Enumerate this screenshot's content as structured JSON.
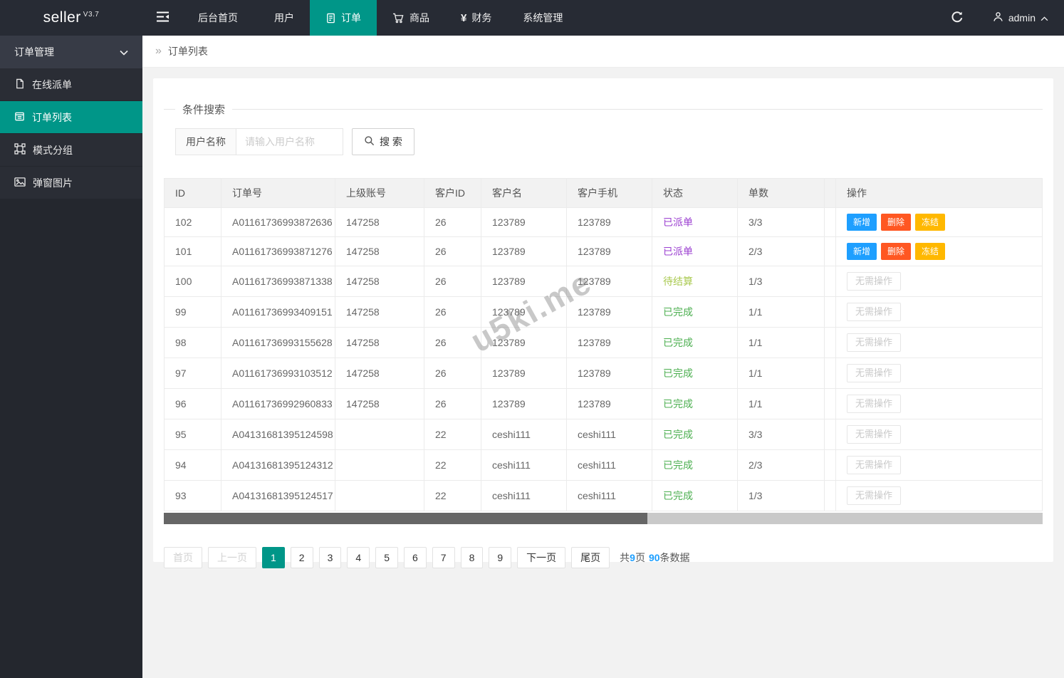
{
  "navbar": {
    "logo_text": "seller",
    "version": "V3.7",
    "items": [
      {
        "label": "后台首页",
        "icon": null,
        "active": false
      },
      {
        "label": "用户",
        "icon": "user-icon",
        "active": false
      },
      {
        "label": "订单",
        "icon": "order-icon",
        "active": true
      },
      {
        "label": "商品",
        "icon": "cart-icon",
        "active": false
      },
      {
        "label": "财务",
        "icon": "yen-icon",
        "active": false
      },
      {
        "label": "系统管理",
        "icon": null,
        "active": false
      }
    ],
    "user_name": "admin"
  },
  "sidebar": {
    "section_label": "订单管理",
    "items": [
      {
        "label": "在线派单",
        "icon": "file-icon",
        "active": false
      },
      {
        "label": "订单列表",
        "icon": "list-icon",
        "active": true
      },
      {
        "label": "模式分组",
        "icon": "group-icon",
        "active": false
      },
      {
        "label": "弹窗图片",
        "icon": "image-icon",
        "active": false
      }
    ]
  },
  "breadcrumb": {
    "arrow": "»",
    "label": "订单列表"
  },
  "search": {
    "legend": "条件搜索",
    "field_label": "用户名称",
    "placeholder": "请输入用户名称",
    "button_label": "搜 索"
  },
  "icons": {
    "yen": "¥"
  },
  "table": {
    "columns": [
      "ID",
      "订单号",
      "上级账号",
      "客户ID",
      "客户名",
      "客户手机",
      "状态",
      "单数",
      "操作"
    ],
    "status_colors": {
      "已派单": "#9b3fd0",
      "待结算": "#a9c94f",
      "已完成": "#4caf50"
    },
    "action_buttons": [
      {
        "label": "新增",
        "color": "#1E9FFF"
      },
      {
        "label": "删除",
        "color": "#FF5722"
      },
      {
        "label": "冻结",
        "color": "#FFB800"
      }
    ],
    "no_action_label": "无需操作",
    "rows": [
      {
        "id": "102",
        "order_no": "A01161736993872636",
        "parent_account": "147258",
        "customer_id": "26",
        "customer_name": "123789",
        "customer_phone": "123789",
        "status": "已派单",
        "count": "3/3",
        "has_actions": true
      },
      {
        "id": "101",
        "order_no": "A01161736993871276",
        "parent_account": "147258",
        "customer_id": "26",
        "customer_name": "123789",
        "customer_phone": "123789",
        "status": "已派单",
        "count": "2/3",
        "has_actions": true
      },
      {
        "id": "100",
        "order_no": "A01161736993871338",
        "parent_account": "147258",
        "customer_id": "26",
        "customer_name": "123789",
        "customer_phone": "123789",
        "status": "待结算",
        "count": "1/3",
        "has_actions": false
      },
      {
        "id": "99",
        "order_no": "A01161736993409151",
        "parent_account": "147258",
        "customer_id": "26",
        "customer_name": "123789",
        "customer_phone": "123789",
        "status": "已完成",
        "count": "1/1",
        "has_actions": false
      },
      {
        "id": "98",
        "order_no": "A01161736993155628",
        "parent_account": "147258",
        "customer_id": "26",
        "customer_name": "123789",
        "customer_phone": "123789",
        "status": "已完成",
        "count": "1/1",
        "has_actions": false
      },
      {
        "id": "97",
        "order_no": "A01161736993103512",
        "parent_account": "147258",
        "customer_id": "26",
        "customer_name": "123789",
        "customer_phone": "123789",
        "status": "已完成",
        "count": "1/1",
        "has_actions": false
      },
      {
        "id": "96",
        "order_no": "A01161736992960833",
        "parent_account": "147258",
        "customer_id": "26",
        "customer_name": "123789",
        "customer_phone": "123789",
        "status": "已完成",
        "count": "1/1",
        "has_actions": false
      },
      {
        "id": "95",
        "order_no": "A04131681395124598",
        "parent_account": "",
        "customer_id": "22",
        "customer_name": "ceshi111",
        "customer_phone": "ceshi111",
        "status": "已完成",
        "count": "3/3",
        "has_actions": false
      },
      {
        "id": "94",
        "order_no": "A04131681395124312",
        "parent_account": "",
        "customer_id": "22",
        "customer_name": "ceshi111",
        "customer_phone": "ceshi111",
        "status": "已完成",
        "count": "2/3",
        "has_actions": false
      },
      {
        "id": "93",
        "order_no": "A04131681395124517",
        "parent_account": "",
        "customer_id": "22",
        "customer_name": "ceshi111",
        "customer_phone": "ceshi111",
        "status": "已完成",
        "count": "1/3",
        "has_actions": false
      }
    ]
  },
  "pagination": {
    "first_label": "首页",
    "prev_label": "上一页",
    "pages": [
      "1",
      "2",
      "3",
      "4",
      "5",
      "6",
      "7",
      "8",
      "9"
    ],
    "active_page": "1",
    "next_label": "下一页",
    "last_label": "尾页",
    "summary": {
      "prefix": "共",
      "total_pages": "9",
      "pages_unit": "页",
      "total_records": "90",
      "records_unit": "条数据"
    }
  },
  "watermark": "u5ki.me",
  "theme": {
    "accent": "#009688",
    "link_blue": "#1E9FFF"
  }
}
